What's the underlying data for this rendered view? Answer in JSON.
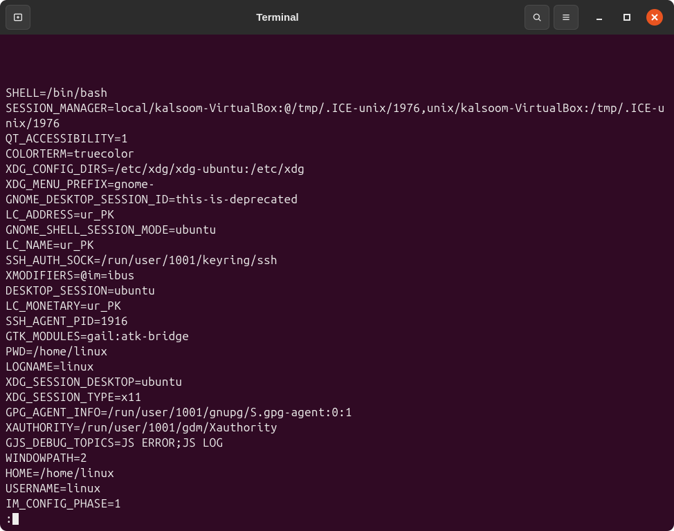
{
  "window": {
    "title": "Terminal"
  },
  "terminal": {
    "lines": [
      "SHELL=/bin/bash",
      "SESSION_MANAGER=local/kalsoom-VirtualBox:@/tmp/.ICE-unix/1976,unix/kalsoom-VirtualBox:/tmp/.ICE-unix/1976",
      "QT_ACCESSIBILITY=1",
      "COLORTERM=truecolor",
      "XDG_CONFIG_DIRS=/etc/xdg/xdg-ubuntu:/etc/xdg",
      "XDG_MENU_PREFIX=gnome-",
      "GNOME_DESKTOP_SESSION_ID=this-is-deprecated",
      "LC_ADDRESS=ur_PK",
      "GNOME_SHELL_SESSION_MODE=ubuntu",
      "LC_NAME=ur_PK",
      "SSH_AUTH_SOCK=/run/user/1001/keyring/ssh",
      "XMODIFIERS=@im=ibus",
      "DESKTOP_SESSION=ubuntu",
      "LC_MONETARY=ur_PK",
      "SSH_AGENT_PID=1916",
      "GTK_MODULES=gail:atk-bridge",
      "PWD=/home/linux",
      "LOGNAME=linux",
      "XDG_SESSION_DESKTOP=ubuntu",
      "XDG_SESSION_TYPE=x11",
      "GPG_AGENT_INFO=/run/user/1001/gnupg/S.gpg-agent:0:1",
      "XAUTHORITY=/run/user/1001/gdm/Xauthority",
      "GJS_DEBUG_TOPICS=JS ERROR;JS LOG",
      "WINDOWPATH=2",
      "HOME=/home/linux",
      "USERNAME=linux",
      "IM_CONFIG_PHASE=1"
    ],
    "prompt_char": ":"
  }
}
